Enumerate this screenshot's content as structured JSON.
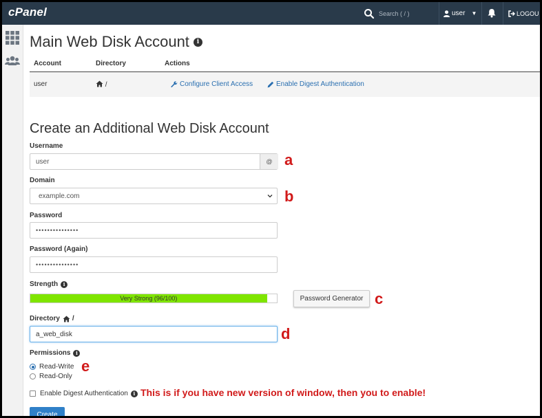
{
  "topbar": {
    "logo": "cPanel",
    "search_placeholder": "Search ( / )",
    "user_label": "user",
    "logout_label": "LOGOU"
  },
  "sidebar": {
    "items": [
      {
        "icon": "grid-icon"
      },
      {
        "icon": "users-icon"
      }
    ]
  },
  "main_account": {
    "title": "Main Web Disk Account",
    "columns": [
      "Account",
      "Directory",
      "Actions"
    ],
    "row": {
      "account": "user",
      "directory": "/",
      "actions": [
        "Configure Client Access",
        "Enable Digest Authentication"
      ]
    }
  },
  "create_form": {
    "title": "Create an Additional Web Disk Account",
    "username_label": "Username",
    "username_value": "user",
    "username_addon": "@",
    "domain_label": "Domain",
    "domain_value": "example.com",
    "password_label": "Password",
    "password_value": "•••••••••••••••",
    "password_again_label": "Password (Again)",
    "password_again_value": "•••••••••••••••",
    "strength_label": "Strength",
    "strength_text": "Very Strong (96/100)",
    "strength_value": 96,
    "password_generator_label": "Password Generator",
    "directory_label": "Directory",
    "directory_suffix": "/",
    "directory_value": "a_web_disk",
    "permissions_label": "Permissions",
    "permissions_options": [
      {
        "label": "Read-Write",
        "selected": true
      },
      {
        "label": "Read-Only",
        "selected": false
      }
    ],
    "digest_label": "Enable Digest Authentication",
    "digest_checked": false,
    "create_label": "Create"
  },
  "annotations": {
    "a": "a",
    "b": "b",
    "c": "c",
    "d": "d",
    "e": "e",
    "note": "This is if you have new version of window, then you to enable!"
  },
  "colors": {
    "topbar": "#293a4a",
    "link": "#2a6fb0",
    "strength_fill": "#7fe500",
    "primary_button": "#2f80c8",
    "annotation": "#d11a1a"
  }
}
